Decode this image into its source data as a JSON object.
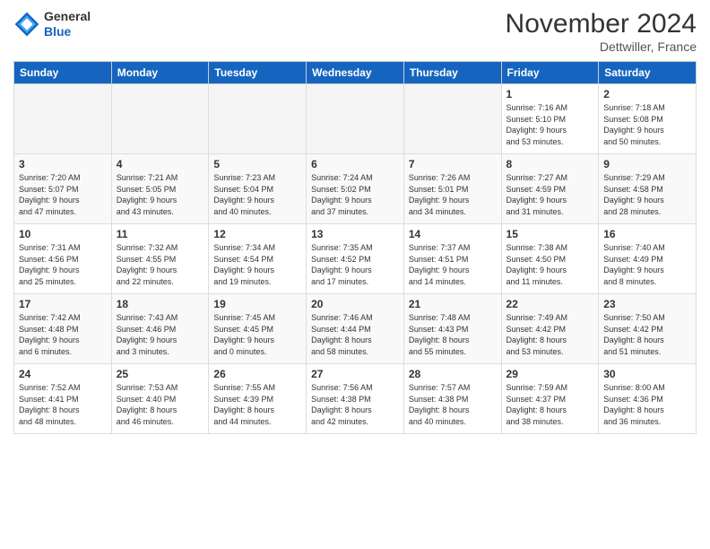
{
  "header": {
    "logo_general": "General",
    "logo_blue": "Blue",
    "month_title": "November 2024",
    "subtitle": "Dettwiller, France"
  },
  "weekdays": [
    "Sunday",
    "Monday",
    "Tuesday",
    "Wednesday",
    "Thursday",
    "Friday",
    "Saturday"
  ],
  "weeks": [
    [
      {
        "day": "",
        "info": ""
      },
      {
        "day": "",
        "info": ""
      },
      {
        "day": "",
        "info": ""
      },
      {
        "day": "",
        "info": ""
      },
      {
        "day": "",
        "info": ""
      },
      {
        "day": "1",
        "info": "Sunrise: 7:16 AM\nSunset: 5:10 PM\nDaylight: 9 hours\nand 53 minutes."
      },
      {
        "day": "2",
        "info": "Sunrise: 7:18 AM\nSunset: 5:08 PM\nDaylight: 9 hours\nand 50 minutes."
      }
    ],
    [
      {
        "day": "3",
        "info": "Sunrise: 7:20 AM\nSunset: 5:07 PM\nDaylight: 9 hours\nand 47 minutes."
      },
      {
        "day": "4",
        "info": "Sunrise: 7:21 AM\nSunset: 5:05 PM\nDaylight: 9 hours\nand 43 minutes."
      },
      {
        "day": "5",
        "info": "Sunrise: 7:23 AM\nSunset: 5:04 PM\nDaylight: 9 hours\nand 40 minutes."
      },
      {
        "day": "6",
        "info": "Sunrise: 7:24 AM\nSunset: 5:02 PM\nDaylight: 9 hours\nand 37 minutes."
      },
      {
        "day": "7",
        "info": "Sunrise: 7:26 AM\nSunset: 5:01 PM\nDaylight: 9 hours\nand 34 minutes."
      },
      {
        "day": "8",
        "info": "Sunrise: 7:27 AM\nSunset: 4:59 PM\nDaylight: 9 hours\nand 31 minutes."
      },
      {
        "day": "9",
        "info": "Sunrise: 7:29 AM\nSunset: 4:58 PM\nDaylight: 9 hours\nand 28 minutes."
      }
    ],
    [
      {
        "day": "10",
        "info": "Sunrise: 7:31 AM\nSunset: 4:56 PM\nDaylight: 9 hours\nand 25 minutes."
      },
      {
        "day": "11",
        "info": "Sunrise: 7:32 AM\nSunset: 4:55 PM\nDaylight: 9 hours\nand 22 minutes."
      },
      {
        "day": "12",
        "info": "Sunrise: 7:34 AM\nSunset: 4:54 PM\nDaylight: 9 hours\nand 19 minutes."
      },
      {
        "day": "13",
        "info": "Sunrise: 7:35 AM\nSunset: 4:52 PM\nDaylight: 9 hours\nand 17 minutes."
      },
      {
        "day": "14",
        "info": "Sunrise: 7:37 AM\nSunset: 4:51 PM\nDaylight: 9 hours\nand 14 minutes."
      },
      {
        "day": "15",
        "info": "Sunrise: 7:38 AM\nSunset: 4:50 PM\nDaylight: 9 hours\nand 11 minutes."
      },
      {
        "day": "16",
        "info": "Sunrise: 7:40 AM\nSunset: 4:49 PM\nDaylight: 9 hours\nand 8 minutes."
      }
    ],
    [
      {
        "day": "17",
        "info": "Sunrise: 7:42 AM\nSunset: 4:48 PM\nDaylight: 9 hours\nand 6 minutes."
      },
      {
        "day": "18",
        "info": "Sunrise: 7:43 AM\nSunset: 4:46 PM\nDaylight: 9 hours\nand 3 minutes."
      },
      {
        "day": "19",
        "info": "Sunrise: 7:45 AM\nSunset: 4:45 PM\nDaylight: 9 hours\nand 0 minutes."
      },
      {
        "day": "20",
        "info": "Sunrise: 7:46 AM\nSunset: 4:44 PM\nDaylight: 8 hours\nand 58 minutes."
      },
      {
        "day": "21",
        "info": "Sunrise: 7:48 AM\nSunset: 4:43 PM\nDaylight: 8 hours\nand 55 minutes."
      },
      {
        "day": "22",
        "info": "Sunrise: 7:49 AM\nSunset: 4:42 PM\nDaylight: 8 hours\nand 53 minutes."
      },
      {
        "day": "23",
        "info": "Sunrise: 7:50 AM\nSunset: 4:42 PM\nDaylight: 8 hours\nand 51 minutes."
      }
    ],
    [
      {
        "day": "24",
        "info": "Sunrise: 7:52 AM\nSunset: 4:41 PM\nDaylight: 8 hours\nand 48 minutes."
      },
      {
        "day": "25",
        "info": "Sunrise: 7:53 AM\nSunset: 4:40 PM\nDaylight: 8 hours\nand 46 minutes."
      },
      {
        "day": "26",
        "info": "Sunrise: 7:55 AM\nSunset: 4:39 PM\nDaylight: 8 hours\nand 44 minutes."
      },
      {
        "day": "27",
        "info": "Sunrise: 7:56 AM\nSunset: 4:38 PM\nDaylight: 8 hours\nand 42 minutes."
      },
      {
        "day": "28",
        "info": "Sunrise: 7:57 AM\nSunset: 4:38 PM\nDaylight: 8 hours\nand 40 minutes."
      },
      {
        "day": "29",
        "info": "Sunrise: 7:59 AM\nSunset: 4:37 PM\nDaylight: 8 hours\nand 38 minutes."
      },
      {
        "day": "30",
        "info": "Sunrise: 8:00 AM\nSunset: 4:36 PM\nDaylight: 8 hours\nand 36 minutes."
      }
    ]
  ]
}
